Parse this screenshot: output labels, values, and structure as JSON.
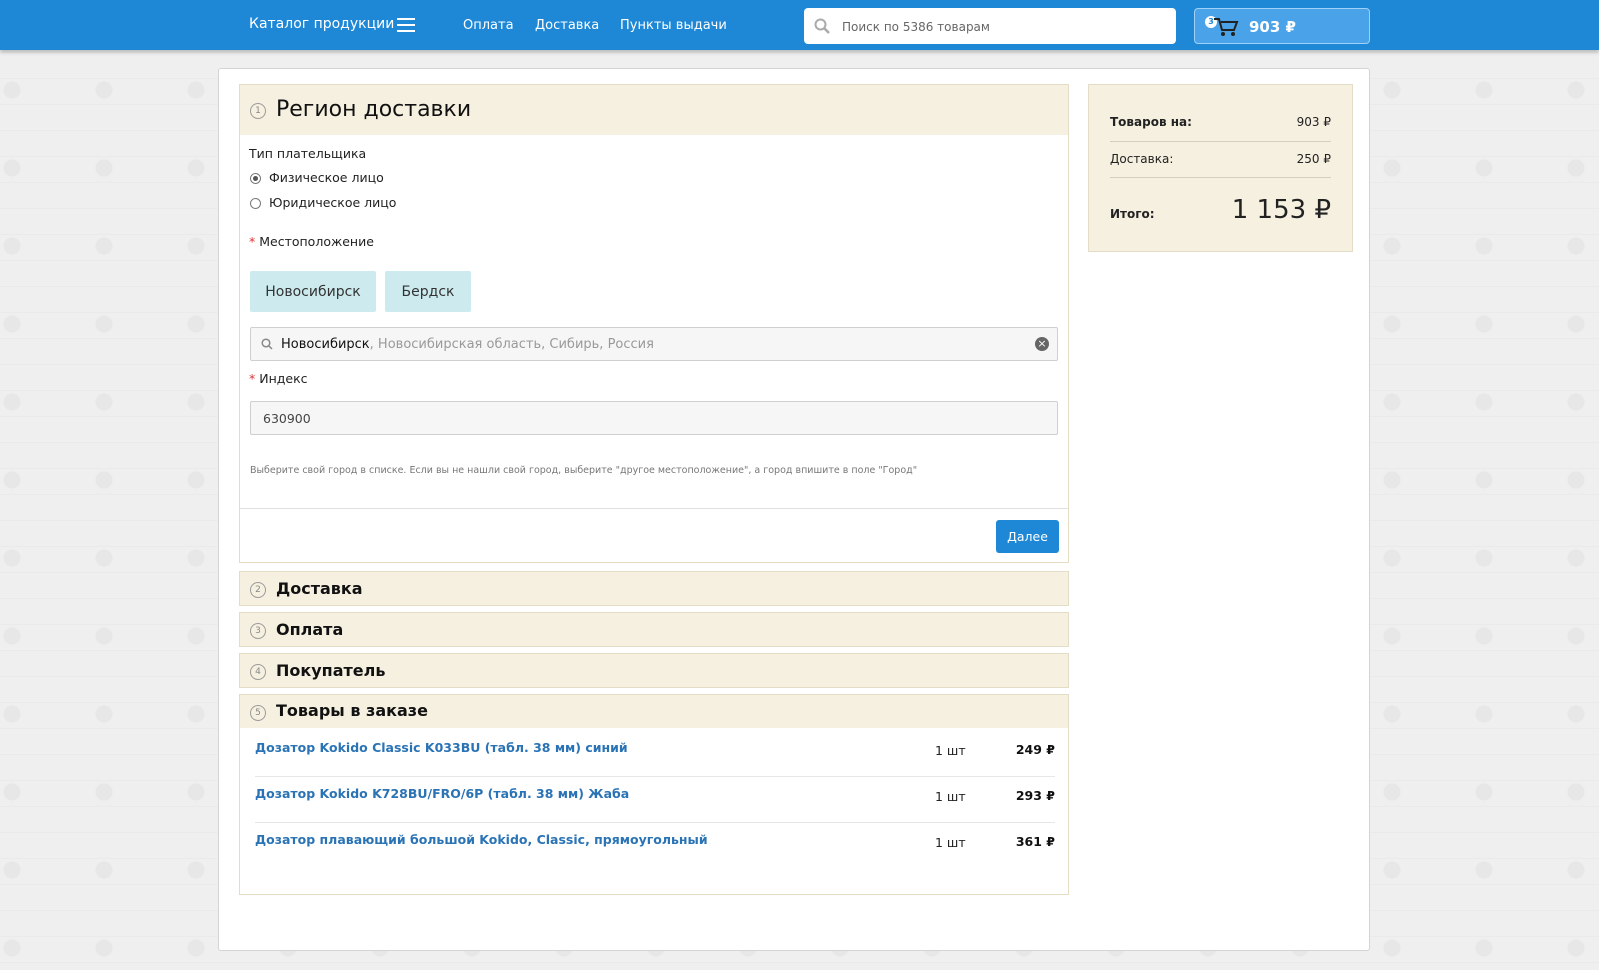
{
  "header": {
    "catalog_label": "Каталог продукции",
    "nav": [
      "Оплата",
      "Доставка",
      "Пункты выдачи"
    ],
    "search_placeholder": "Поиск по 5386 товарам",
    "cart_count": "3",
    "cart_total": "903 ₽"
  },
  "step1": {
    "number": "1",
    "title": "Регион доставки",
    "payer_type_label": "Тип плательщика",
    "payer_options": [
      "Физическое лицо",
      "Юридическое лицо"
    ],
    "selected_payer": "Физическое лицо",
    "location_label": "Местоположение",
    "city_buttons": [
      "Новосибирск",
      "Бердск"
    ],
    "location_value": "Новосибирск",
    "location_rest": ", Новосибирская область, Сибирь, Россия",
    "index_label": "Индекс",
    "index_value": "630900",
    "hint": "Выберите свой город в списке. Если вы не нашли свой город, выберите \"другое местоположение\", а город впишите в поле \"Город\"",
    "next_label": "Далее"
  },
  "steps": [
    {
      "number": "2",
      "title": "Доставка"
    },
    {
      "number": "3",
      "title": "Оплата"
    },
    {
      "number": "4",
      "title": "Покупатель"
    }
  ],
  "step5": {
    "number": "5",
    "title": "Товары в заказе",
    "items": [
      {
        "name": "Дозатор Kokido Classic K033BU (табл. 38 мм) синий",
        "qty": "1 шт",
        "price": "249 ₽"
      },
      {
        "name": "Дозатор Kokido K728BU/FRO/6P (табл. 38 мм) Жаба",
        "qty": "1 шт",
        "price": "293 ₽"
      },
      {
        "name": "Дозатор плавающий большой Kokido, Classic, прямоугольный",
        "qty": "1 шт",
        "price": "361 ₽"
      }
    ]
  },
  "summary": {
    "goods_label": "Товаров на:",
    "goods_value": "903 ₽",
    "delivery_label": "Доставка:",
    "delivery_value": "250 ₽",
    "total_label": "Итого:",
    "total_value": "1 153 ₽"
  },
  "colors": {
    "header_blue": "#1e88d6",
    "step_header": "#f6f0e0",
    "city_button": "#cdebef",
    "link_blue": "#2a73b5"
  }
}
